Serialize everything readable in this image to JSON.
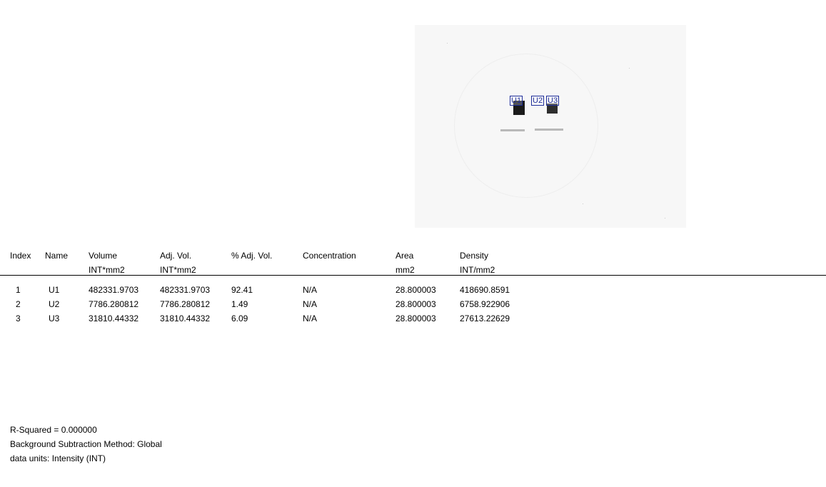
{
  "gel_labels": [
    "U1",
    "U2",
    "U3"
  ],
  "table": {
    "headers": [
      {
        "name": "Index",
        "unit": ""
      },
      {
        "name": "Name",
        "unit": ""
      },
      {
        "name": "Volume",
        "unit": "INT*mm2"
      },
      {
        "name": "Adj. Vol.",
        "unit": "INT*mm2"
      },
      {
        "name": "% Adj. Vol.",
        "unit": ""
      },
      {
        "name": "Concentration",
        "unit": ""
      },
      {
        "name": "Area",
        "unit": "mm2"
      },
      {
        "name": "Density",
        "unit": "INT/mm2"
      }
    ],
    "rows": [
      [
        "1",
        "U1",
        "482331.9703",
        "482331.9703",
        "92.41",
        "N/A",
        "28.800003",
        "418690.8591"
      ],
      [
        "2",
        "U2",
        "7786.280812",
        "7786.280812",
        "1.49",
        "N/A",
        "28.800003",
        "6758.922906"
      ],
      [
        "3",
        "U3",
        "31810.44332",
        "31810.44332",
        "6.09",
        "N/A",
        "28.800003",
        "27613.22629"
      ]
    ]
  },
  "footer": {
    "r_squared": "R-Squared = 0.000000",
    "bg_method": "Background Subtraction Method:  Global",
    "data_units": "data units: Intensity  (INT)"
  }
}
